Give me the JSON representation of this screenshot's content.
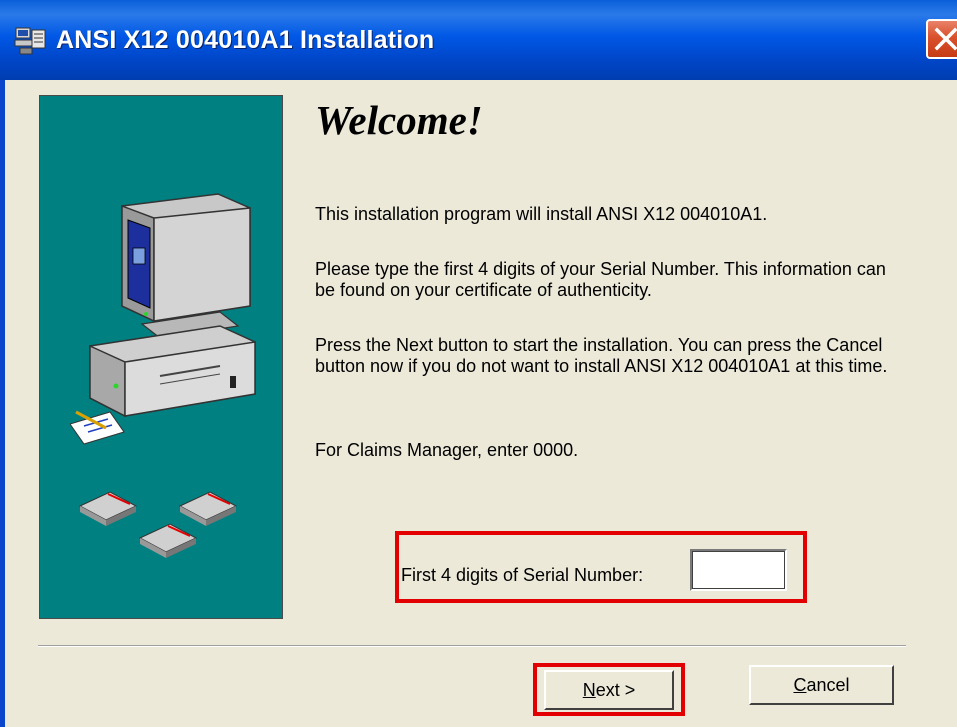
{
  "window": {
    "title": "ANSI X12 004010A1 Installation",
    "icon": "installer-icon",
    "close_icon": "close-icon"
  },
  "content": {
    "heading": "Welcome!",
    "paragraph_1": "This installation program will install ANSI X12 004010A1.",
    "paragraph_2": "Please type the first 4 digits of your Serial Number.  This information can be found on your certificate of authenticity.",
    "paragraph_3": "Press the Next button to start the installation. You can press the Cancel button now if you do not want to install  ANSI X12 004010A1 at this time.",
    "paragraph_4": "For Claims Manager, enter 0000."
  },
  "serial": {
    "label": "First 4 digits of Serial Number:",
    "value": ""
  },
  "buttons": {
    "next_mnemonic": "N",
    "next_rest": "ext >",
    "cancel_mnemonic": "C",
    "cancel_rest": "ancel"
  },
  "colors": {
    "side_panel": "#008080",
    "titlebar": "#0058e6",
    "highlight": "#e30000",
    "dialog_bg": "#ece9d8"
  }
}
